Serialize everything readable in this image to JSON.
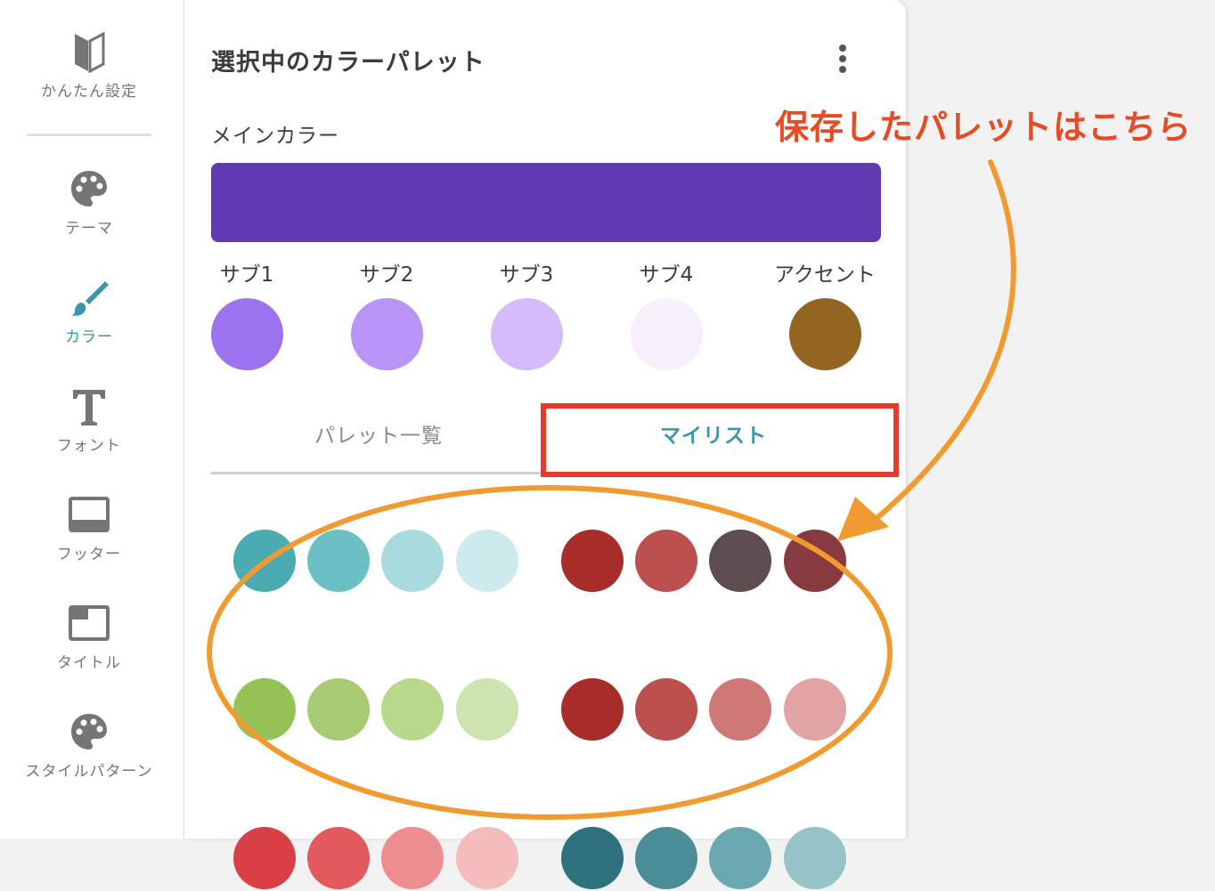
{
  "sidebar": {
    "items": [
      {
        "label": "かんたん設定",
        "icon": "beginner-mark-icon",
        "active": false
      },
      {
        "label": "テーマ",
        "icon": "palette-icon",
        "active": false
      },
      {
        "label": "カラー",
        "icon": "brush-icon",
        "active": true
      },
      {
        "label": "フォント",
        "icon": "font-icon",
        "active": false
      },
      {
        "label": "フッター",
        "icon": "footer-layout-icon",
        "active": false
      },
      {
        "label": "タイトル",
        "icon": "title-layout-icon",
        "active": false
      },
      {
        "label": "スタイルパターン",
        "icon": "palette-icon",
        "active": false
      }
    ]
  },
  "panel": {
    "title": "選択中のカラーパレット",
    "more_icon": "more-vertical-icon",
    "main_color_label": "メインカラー",
    "main_color": "#5f3ab3",
    "subs": [
      {
        "label": "サブ1",
        "color": "#9d74ef"
      },
      {
        "label": "サブ2",
        "color": "#b794f6"
      },
      {
        "label": "サブ3",
        "color": "#d4bbfa"
      },
      {
        "label": "サブ4",
        "color": "#f6f0fd"
      },
      {
        "label": "アクセント",
        "color": "#926621"
      }
    ],
    "tabs": [
      {
        "label": "パレット一覧",
        "active": false
      },
      {
        "label": "マイリスト",
        "active": true
      }
    ],
    "palettes": [
      {
        "left": [
          "#4aacb1",
          "#6ac0c3",
          "#a8dade",
          "#cdeaed"
        ],
        "right": [
          "#a82d28",
          "#bb504e",
          "#5e4d4e",
          "#873a40"
        ]
      },
      {
        "left": [
          "#94c256",
          "#a7cb72",
          "#b8d98c",
          "#cde3b0"
        ],
        "right": [
          "#a82d28",
          "#bb504e",
          "#cf7878",
          "#e2a3a5"
        ]
      },
      {
        "left": [
          "#d94045",
          "#e35a5e",
          "#ee8d90",
          "#f5bcbe"
        ],
        "right": [
          "#2e727c",
          "#4c8e98",
          "#6aa8b2",
          "#95c3c8"
        ]
      }
    ]
  },
  "annotation": {
    "text": "保存したパレットはこちら",
    "text_color": "#e84a25",
    "arrow_color": "#f09a30",
    "highlight_box_color": "#e8392a"
  }
}
